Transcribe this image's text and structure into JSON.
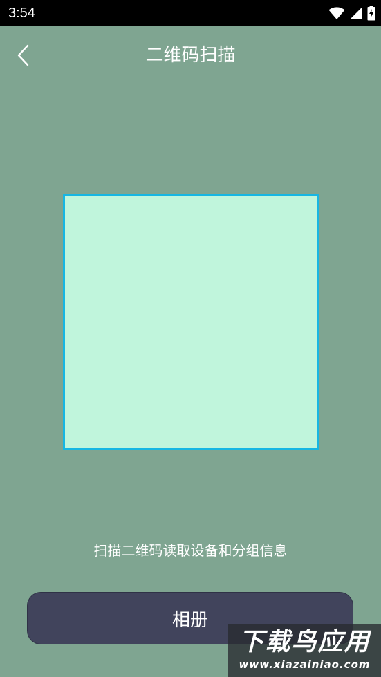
{
  "status_bar": {
    "time": "3:54",
    "icons": [
      "wifi-icon",
      "signal-icon",
      "battery-charging-icon"
    ]
  },
  "header": {
    "title": "二维码扫描",
    "back_icon": "chevron-left-icon"
  },
  "scanner": {
    "hint": "扫描二维码读取设备和分组信息"
  },
  "actions": {
    "album_label": "相册"
  },
  "watermark": {
    "main": "下载鸟应用",
    "url": "www.xiazainiao.com"
  },
  "colors": {
    "background": "#7fa591",
    "status_bar": "#000000",
    "scan_frame_fill": "#c0f5dc",
    "scan_frame_border": "#17b6e3",
    "button": "#41445c",
    "text": "#ffffff"
  }
}
